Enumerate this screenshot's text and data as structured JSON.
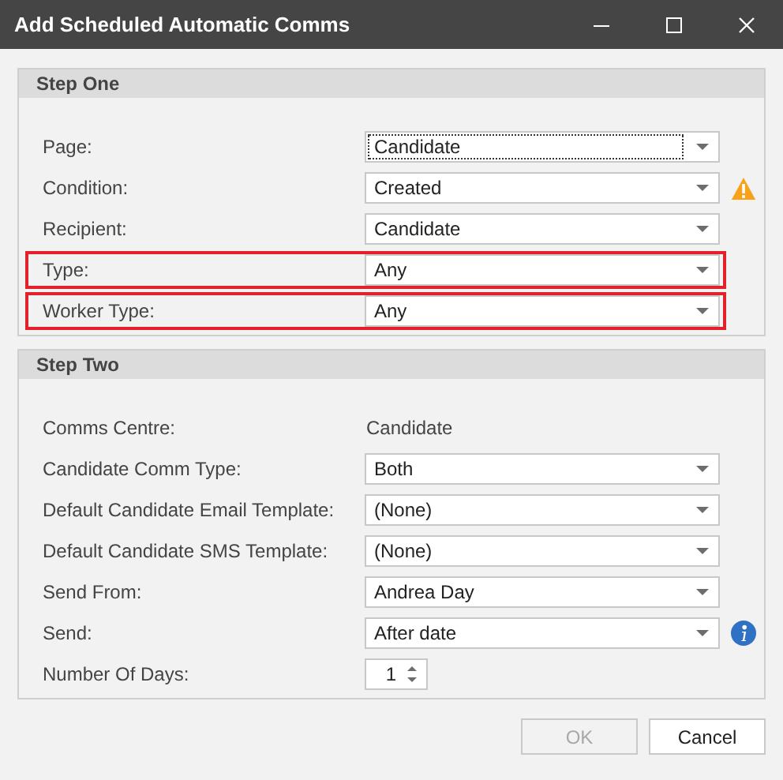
{
  "window": {
    "title": "Add Scheduled Automatic Comms"
  },
  "groups": [
    {
      "title": "Step One",
      "rows": [
        {
          "kind": "combo",
          "label": "Page:",
          "value": "Candidate",
          "focused": true,
          "highlighted": false
        },
        {
          "kind": "combo",
          "label": "Condition:",
          "value": "Created",
          "focused": false,
          "highlighted": false,
          "warning": true
        },
        {
          "kind": "combo",
          "label": "Recipient:",
          "value": "Candidate",
          "focused": false,
          "highlighted": false
        },
        {
          "kind": "combo",
          "label": "Type:",
          "value": "Any",
          "focused": false,
          "highlighted": true
        },
        {
          "kind": "combo",
          "label": "Worker Type:",
          "value": "Any",
          "focused": false,
          "highlighted": true
        }
      ]
    },
    {
      "title": "Step Two",
      "rows": [
        {
          "kind": "text",
          "label": "Comms Centre:",
          "value": "Candidate",
          "highlighted": false
        },
        {
          "kind": "combo",
          "label": "Candidate Comm Type:",
          "value": "Both",
          "focused": false,
          "highlighted": false
        },
        {
          "kind": "combo",
          "label": "Default Candidate Email Template:",
          "value": "(None)",
          "focused": false,
          "highlighted": false
        },
        {
          "kind": "combo",
          "label": "Default Candidate SMS Template:",
          "value": "(None)",
          "focused": false,
          "highlighted": false
        },
        {
          "kind": "combo",
          "label": "Send From:",
          "value": "Andrea Day",
          "focused": false,
          "highlighted": false
        },
        {
          "kind": "combo",
          "label": "Send:",
          "value": "After date",
          "focused": false,
          "highlighted": false,
          "info": true
        },
        {
          "kind": "spin",
          "label": "Number Of Days:",
          "value": "1",
          "highlighted": false
        }
      ]
    }
  ],
  "buttons": [
    {
      "label": "OK",
      "disabled": true
    },
    {
      "label": "Cancel",
      "disabled": false
    }
  ]
}
